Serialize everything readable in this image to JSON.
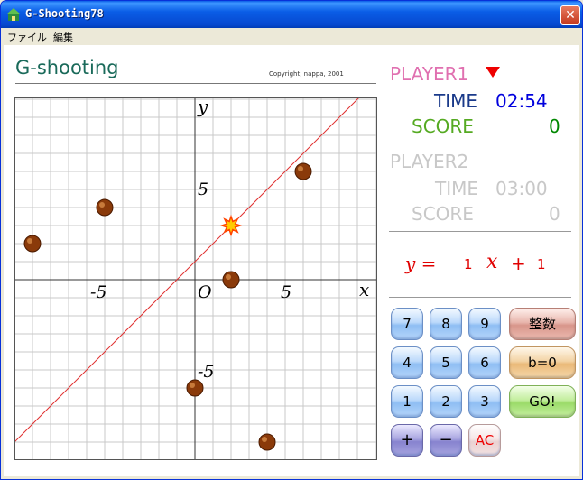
{
  "window": {
    "title": "G-Shooting78",
    "close_label": "✕"
  },
  "menu": {
    "items": [
      "ファイル",
      "編集"
    ]
  },
  "app": {
    "title": "G-shooting",
    "copyright": "Copyright, nappa, 2001"
  },
  "graph": {
    "x_axis_label": "x",
    "y_axis_label": "y",
    "origin_label": "O",
    "tick_labels": {
      "x_neg": "-5",
      "x_pos": "5",
      "y_pos": "5",
      "y_neg": "-5"
    },
    "range": [
      -10,
      10
    ],
    "grid": true,
    "line": {
      "slope": 1,
      "intercept": 1,
      "color": "#e03030"
    },
    "targets": [
      {
        "x": -9,
        "y": 2
      },
      {
        "x": -5,
        "y": 4
      },
      {
        "x": 6,
        "y": 6
      },
      {
        "x": 2,
        "y": 0
      },
      {
        "x": 0,
        "y": -6
      },
      {
        "x": 4,
        "y": -9
      }
    ],
    "hits": [
      {
        "x": 2,
        "y": 3
      }
    ]
  },
  "player1": {
    "label": "PLAYER1",
    "time_label": "TIME",
    "time": "02:54",
    "score_label": "SCORE",
    "score": "0"
  },
  "player2": {
    "label": "PLAYER2",
    "time_label": "TIME",
    "time": "03:00",
    "score_label": "SCORE",
    "score": "0"
  },
  "equation": {
    "lhs": "y =",
    "coef": "1",
    "var": "x",
    "op": "+",
    "const": "1"
  },
  "keypad": {
    "digits": [
      "7",
      "8",
      "9",
      "4",
      "5",
      "6",
      "1",
      "2",
      "3"
    ],
    "plus": "+",
    "minus": "−",
    "ac": "AC",
    "seisu": "整数",
    "b0": "b=0",
    "go": "GO!"
  },
  "colors": {
    "title_bar": "#0a5de6",
    "player1": "#e070b0",
    "time_label": "#1a3a8a",
    "time_value": "#0000dd",
    "score_label": "#55aa22",
    "score_value": "#008800",
    "inactive": "#c8c8c8",
    "equation": "#e00000",
    "ball": "#8a3a0a"
  }
}
